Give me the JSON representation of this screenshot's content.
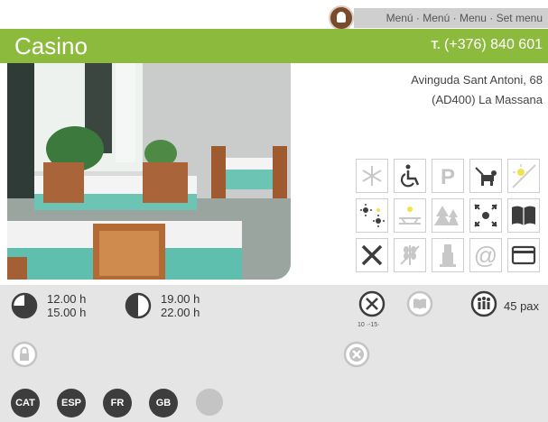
{
  "header": {
    "menu_links": "Menú · Menú · Menu · Set menu",
    "title": "Casino",
    "phone_prefix": "T.",
    "phone": "(+376) 840 601"
  },
  "address": {
    "line1": "Avinguda Sant Antoni, 68",
    "line2": "(AD400) La Massana"
  },
  "service_icons": [
    "air-conditioning-icon",
    "wheelchair-access-icon",
    "parking-icon",
    "pets-allowed-icon",
    "terrace-sun-icon",
    "outdoor-terrace-icon",
    "scenic-view-icon",
    "mountain-forest-icon",
    "kids-area-icon",
    "menu-book-icon",
    "cutlery-icon",
    "gluten-free-icon",
    "wine-cellar-icon",
    "email-icon",
    "credit-card-icon"
  ],
  "schedule": {
    "lunch_open": "12.00 h",
    "lunch_close": "15.00 h",
    "dinner_open": "19.00 h",
    "dinner_close": "22.00 h"
  },
  "meal_price": "10 ·-15·",
  "capacity": "45 pax",
  "languages": [
    "CAT",
    "ESP",
    "FR",
    "GB"
  ],
  "colors": {
    "brand_green": "#8cba3c",
    "icon_dark": "#3d3d3d",
    "icon_light": "#c4c4c4"
  }
}
